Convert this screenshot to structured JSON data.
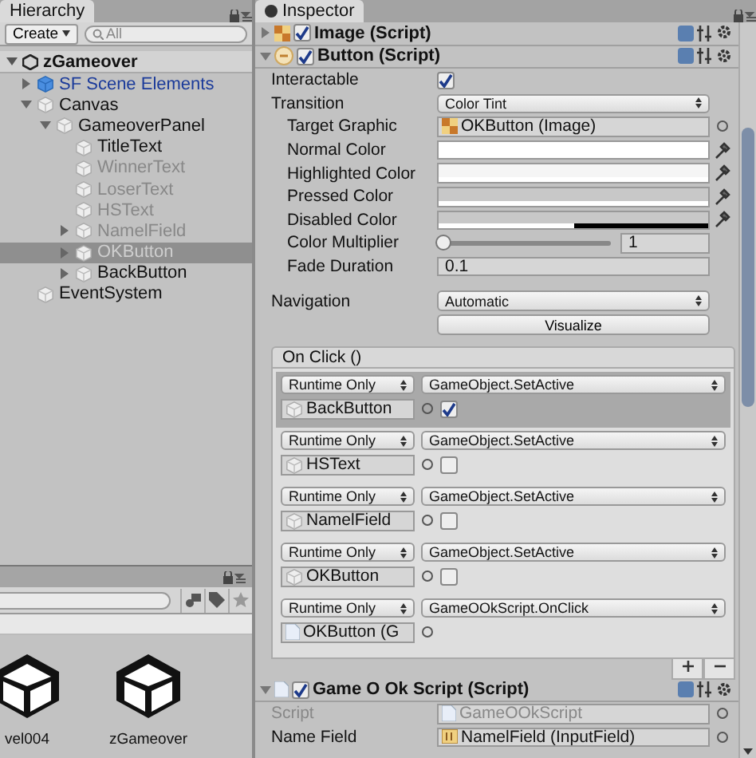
{
  "hierarchy": {
    "tab": "Hierarchy",
    "create": "Create",
    "search_placeholder": "All",
    "scene": {
      "name": "zGameover",
      "expanded": true
    },
    "items": [
      {
        "name": "SF Scene Elements",
        "prefab": true,
        "active": true,
        "selected": false,
        "expanded": false
      },
      {
        "name": "Canvas",
        "prefab": false,
        "active": true,
        "selected": false,
        "expanded": true,
        "children": [
          {
            "name": "GameoverPanel",
            "prefab": false,
            "active": true,
            "selected": false,
            "expanded": true,
            "children": [
              {
                "name": "TitleText",
                "prefab": false,
                "active": true,
                "selected": false
              },
              {
                "name": "WinnerText",
                "prefab": false,
                "active": false,
                "selected": false
              },
              {
                "name": "LoserText",
                "prefab": false,
                "active": false,
                "selected": false
              },
              {
                "name": "HSText",
                "prefab": false,
                "active": false,
                "selected": false
              },
              {
                "name": "NamelField",
                "prefab": false,
                "active": false,
                "selected": false,
                "expanded": false
              },
              {
                "name": "OKButton",
                "prefab": false,
                "active": false,
                "selected": true,
                "expanded": false
              },
              {
                "name": "BackButton",
                "prefab": false,
                "active": true,
                "selected": false,
                "expanded": false
              }
            ]
          }
        ]
      },
      {
        "name": "EventSystem",
        "prefab": false,
        "active": true,
        "selected": false
      }
    ]
  },
  "project": {
    "assets": [
      {
        "name": "vel004"
      },
      {
        "name": "zGameover"
      }
    ]
  },
  "inspector": {
    "tab": "Inspector",
    "components": [
      {
        "title": "Image (Script)",
        "kind": "image",
        "enabled": true,
        "expanded": false
      },
      {
        "title": "Button (Script)",
        "kind": "button",
        "enabled": true,
        "expanded": true,
        "fields": [
          {
            "kind": "checkbox",
            "label": "Interactable",
            "checked": true
          },
          {
            "kind": "dropdown",
            "label": "Transition",
            "value": "Color Tint",
            "children": [
              {
                "kind": "imageref",
                "label": "Target Graphic",
                "value": "OKButton (Image)",
                "disabled": false
              },
              {
                "kind": "color",
                "label": "Normal Color",
                "color": "#ffffff",
                "level": 1
              },
              {
                "kind": "color",
                "label": "Highlighted Color",
                "color": "#f5f5f5",
                "level": 1
              },
              {
                "kind": "color",
                "label": "Pressed Color",
                "color": "#c8c8c8",
                "level": 1
              },
              {
                "kind": "color",
                "label": "Disabled Color",
                "color": "#c8c8c8",
                "level": 0.5
              },
              {
                "kind": "slider",
                "label": "Color Multiplier",
                "level": 0,
                "value": "1"
              },
              {
                "kind": "number",
                "label": "Fade Duration",
                "value": "0.1"
              }
            ]
          },
          {
            "kind": "dropdown",
            "label": "Navigation",
            "value": "Automatic"
          },
          {
            "kind": "button",
            "value": "Visualize"
          },
          {
            "kind": "event",
            "label": "On Click ()",
            "entries": [
              {
                "kind": "toggle",
                "mode": "Runtime Only",
                "function": "GameObject.SetActive",
                "target": "BackButton",
                "checked": true,
                "selected": true
              },
              {
                "kind": "toggle",
                "mode": "Runtime Only",
                "function": "GameObject.SetActive",
                "target": "HSText",
                "checked": false,
                "selected": false
              },
              {
                "kind": "toggle",
                "mode": "Runtime Only",
                "function": "GameObject.SetActive",
                "target": "NamelField",
                "checked": false,
                "selected": false
              },
              {
                "kind": "toggle",
                "mode": "Runtime Only",
                "function": "GameObject.SetActive",
                "target": "OKButton",
                "checked": false,
                "selected": false
              },
              {
                "kind": "plain",
                "mode": "Runtime Only",
                "function": "GameOOkScript.OnClick",
                "target": "OKButton (G",
                "selected": false
              }
            ]
          }
        ]
      },
      {
        "title": "Game O Ok Script (Script)",
        "kind": "script",
        "enabled": true,
        "expanded": true,
        "fields": [
          {
            "kind": "scriptref",
            "label": "Script",
            "value": "GameOOkScript",
            "disabled": true
          },
          {
            "kind": "fieldref",
            "label": "Name Field",
            "value": "NamelField (InputField)",
            "disabled": false
          }
        ]
      }
    ]
  }
}
